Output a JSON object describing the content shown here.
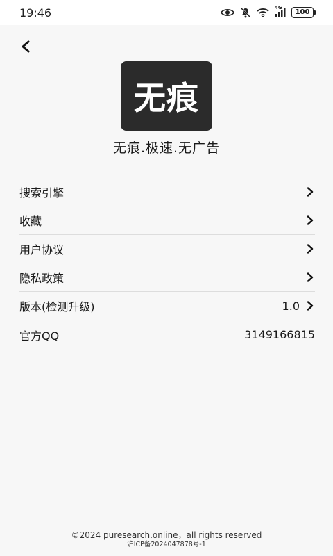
{
  "status_bar": {
    "time": "19:46",
    "network": "4G",
    "battery": "100",
    "icons": [
      "eye-icon",
      "bell-muted-icon",
      "wifi-icon",
      "signal-4g-icon",
      "battery-icon"
    ]
  },
  "header": {
    "back_icon": "chevron-left-icon"
  },
  "logo": {
    "text": "无痕"
  },
  "tagline": "无痕.极速.无广告",
  "menu": {
    "items": [
      {
        "label": "搜索引擎",
        "value": "",
        "chevron": true
      },
      {
        "label": "收藏",
        "value": "",
        "chevron": true
      },
      {
        "label": "用户协议",
        "value": "",
        "chevron": true
      },
      {
        "label": "隐私政策",
        "value": "",
        "chevron": true
      },
      {
        "label": "版本(检测升级)",
        "value": "1.0",
        "chevron": true
      },
      {
        "label": "官方QQ",
        "value": "3149166815",
        "chevron": false
      }
    ]
  },
  "footer": {
    "copyright": "©2024 puresearch.online，all rights reserved",
    "icp": "沪ICP备2024047878号-1"
  },
  "colors": {
    "background": "#f7f7f7",
    "logo_bg": "#2b2b2b",
    "divider": "#dddddd"
  }
}
